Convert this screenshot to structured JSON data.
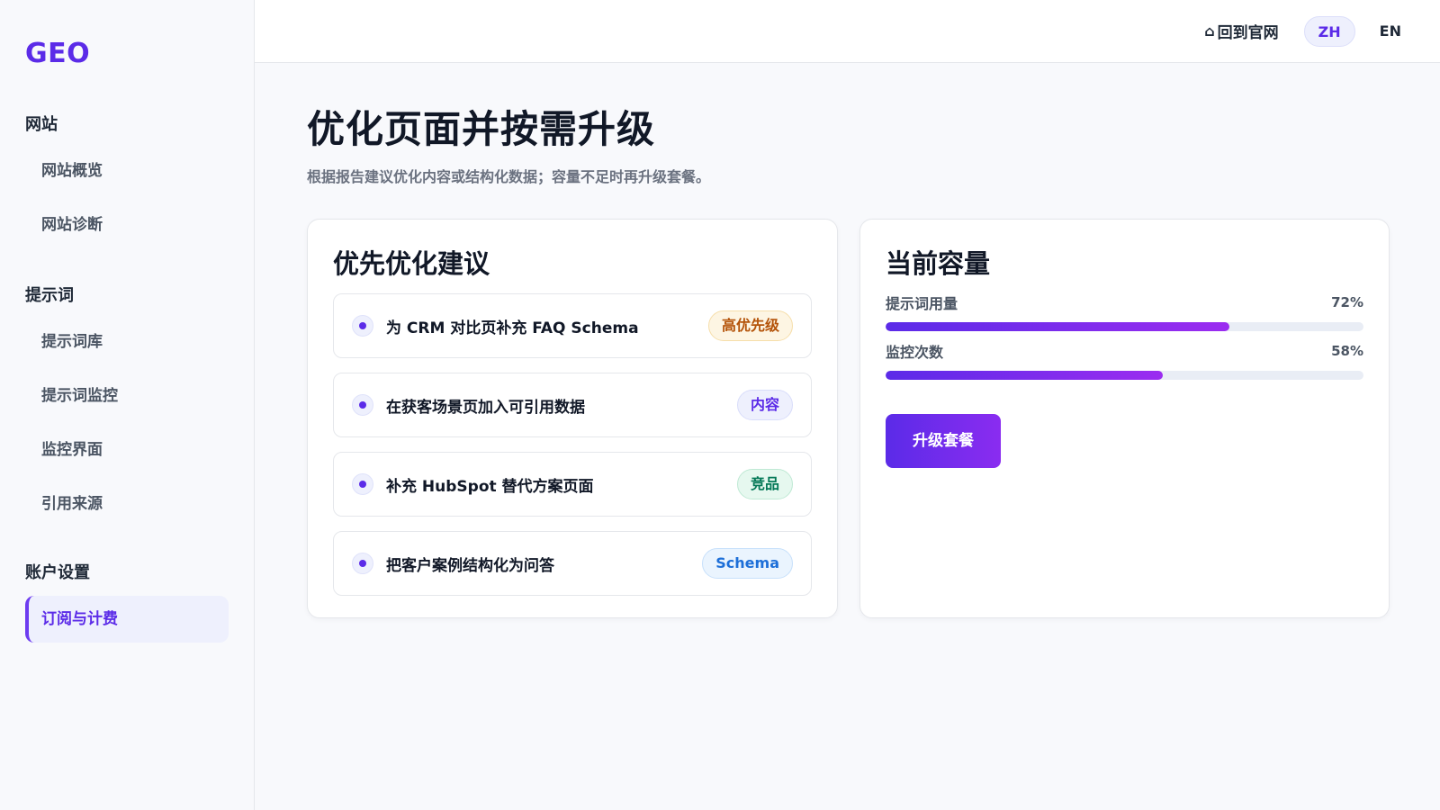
{
  "sidebar": {
    "logo": "GEO",
    "groups": [
      {
        "title": "网站",
        "items": [
          {
            "label": "网站概览"
          },
          {
            "label": "网站诊断"
          }
        ]
      },
      {
        "title": "提示词",
        "items": [
          {
            "label": "提示词库"
          },
          {
            "label": "提示词监控"
          },
          {
            "label": "监控界面"
          },
          {
            "label": "引用来源"
          }
        ]
      },
      {
        "title": "账户设置",
        "items": [
          {
            "label": "订阅与计费",
            "active": true
          }
        ]
      }
    ]
  },
  "topbar": {
    "home_icon": "⌂",
    "home_label": "回到官网",
    "lang_zh": "ZH",
    "lang_en": "EN",
    "active_lang": "ZH"
  },
  "page": {
    "title": "优化页面并按需升级",
    "subtitle": "根据报告建议优化内容或结构化数据；容量不足时再升级套餐。"
  },
  "suggestions": {
    "title": "优先优化建议",
    "items": [
      {
        "text": "为 CRM 对比页补充 FAQ Schema",
        "tag": "高优先级",
        "tag_color": "#b45309"
      },
      {
        "text": "在获客场景页加入可引用数据",
        "tag": "内容",
        "tag_color": "#5b2be8"
      },
      {
        "text": "补充 HubSpot 替代方案页面",
        "tag": "竞品",
        "tag_color": "#047857"
      },
      {
        "text": "把客户案例结构化为问答",
        "tag": "Schema",
        "tag_color": "#1d6fd8"
      }
    ]
  },
  "capacity": {
    "title": "当前容量",
    "meters": [
      {
        "label": "提示词用量",
        "value_text": "72%",
        "percent": 72
      },
      {
        "label": "监控次数",
        "value_text": "58%",
        "percent": 58
      }
    ],
    "upgrade_label": "升级套餐"
  },
  "colors": {
    "accent": "#5b2be8",
    "accent_gradient_end": "#9b2cf0"
  }
}
